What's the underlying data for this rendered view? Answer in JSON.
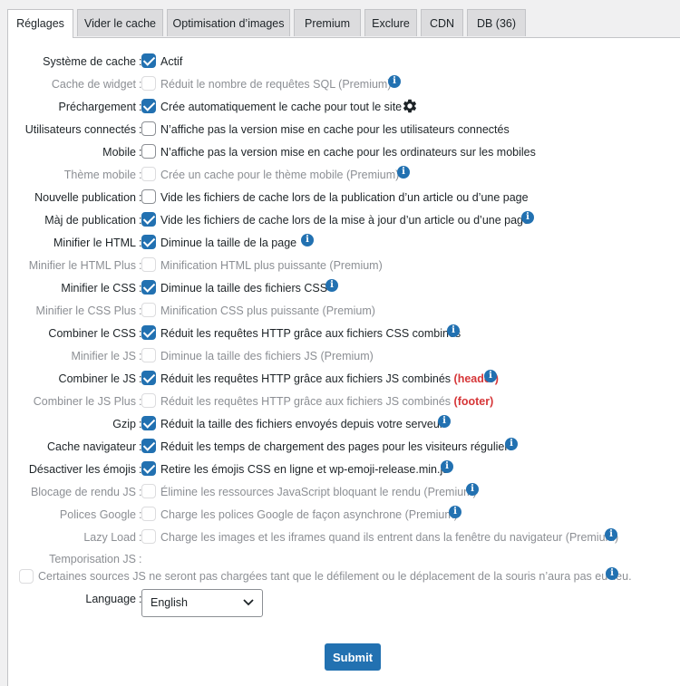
{
  "tabs": [
    "Réglages",
    "Vider le cache",
    "Optimisation d’images",
    "Premium",
    "Exclure",
    "CDN",
    "DB (36)"
  ],
  "settings": {
    "cache_system": {
      "label": "Système de cache",
      "text": "Actif"
    },
    "widget_cache": {
      "label": "Cache de widget",
      "text": "Réduit le nombre de requêtes SQL (Premium)"
    },
    "preload": {
      "label": "Préchargement",
      "text": "Crée automatiquement le cache pour tout le site"
    },
    "logged_in": {
      "label": "Utilisateurs connectés",
      "text": "N’affiche pas la version mise en cache pour les utilisateurs connectés"
    },
    "mobile": {
      "label": "Mobile",
      "text": "N’affiche pas la version mise en cache pour les ordinateurs sur les mobiles"
    },
    "mobile_theme": {
      "label": "Thème mobile",
      "text": "Crée un cache pour le thème mobile (Premium)"
    },
    "new_post": {
      "label": "Nouvelle publication",
      "text": "Vide les fichiers de cache lors de la publication d’un article ou d’une page"
    },
    "update_post": {
      "label": "Màj de publication",
      "text": "Vide les fichiers de cache lors de la mise à jour d’un article ou d’une page"
    },
    "minify_html": {
      "label": "Minifier le HTML",
      "text": "Diminue la taille de la page"
    },
    "minify_html_plus": {
      "label": "Minifier le HTML Plus",
      "text": "Minification HTML plus puissante (Premium)"
    },
    "minify_css": {
      "label": "Minifier le CSS",
      "text": "Diminue la taille des fichiers CSS"
    },
    "minify_css_plus": {
      "label": "Minifier le CSS Plus",
      "text": "Minification CSS plus puissante (Premium)"
    },
    "combine_css": {
      "label": "Combiner le CSS",
      "text": "Réduit les requêtes HTTP grâce aux fichiers CSS combinés"
    },
    "minify_js": {
      "label": "Minifier le JS",
      "text": "Diminue la taille des fichiers JS (Premium)"
    },
    "combine_js": {
      "label": "Combiner le JS",
      "text": "Réduit les requêtes HTTP grâce aux fichiers JS combinés",
      "tag": "(header)"
    },
    "combine_js_plus": {
      "label": "Combiner le JS Plus",
      "text": "Réduit les requêtes HTTP grâce aux fichiers JS combinés",
      "tag": "(footer)"
    },
    "gzip": {
      "label": "Gzip",
      "text": "Réduit la taille des fichiers envoyés depuis votre serveur"
    },
    "browser_cache": {
      "label": "Cache navigateur",
      "text": "Réduit les temps de chargement des pages pour les visiteurs réguliers"
    },
    "disable_emojis": {
      "label": "Désactiver les émojis",
      "text": "Retire les émojis CSS en ligne et wp-emoji-release.min.js"
    },
    "render_blocking": {
      "label": "Blocage de rendu JS",
      "text": "Élimine les ressources JavaScript bloquant le rendu (Premium)"
    },
    "google_fonts": {
      "label": "Polices Google",
      "text": "Charge les polices Google de façon asynchrone (Premium)"
    },
    "lazy_load": {
      "label": "Lazy Load",
      "text": "Charge les images et les iframes quand ils entrent dans la fenêtre du navigateur (Premium)"
    },
    "js_delay": {
      "label": "Temporisation JS",
      "text": "Certaines sources JS ne seront pas chargées tant que le défilement ou le déplacement de la souris n’aura pas eu lieu."
    },
    "language": {
      "label": "Language",
      "value": "English"
    }
  },
  "submit_label": "Submit",
  "colors": {
    "accent": "#2271b1",
    "highlight": "#d63638",
    "disabled": "#8c8f94"
  }
}
